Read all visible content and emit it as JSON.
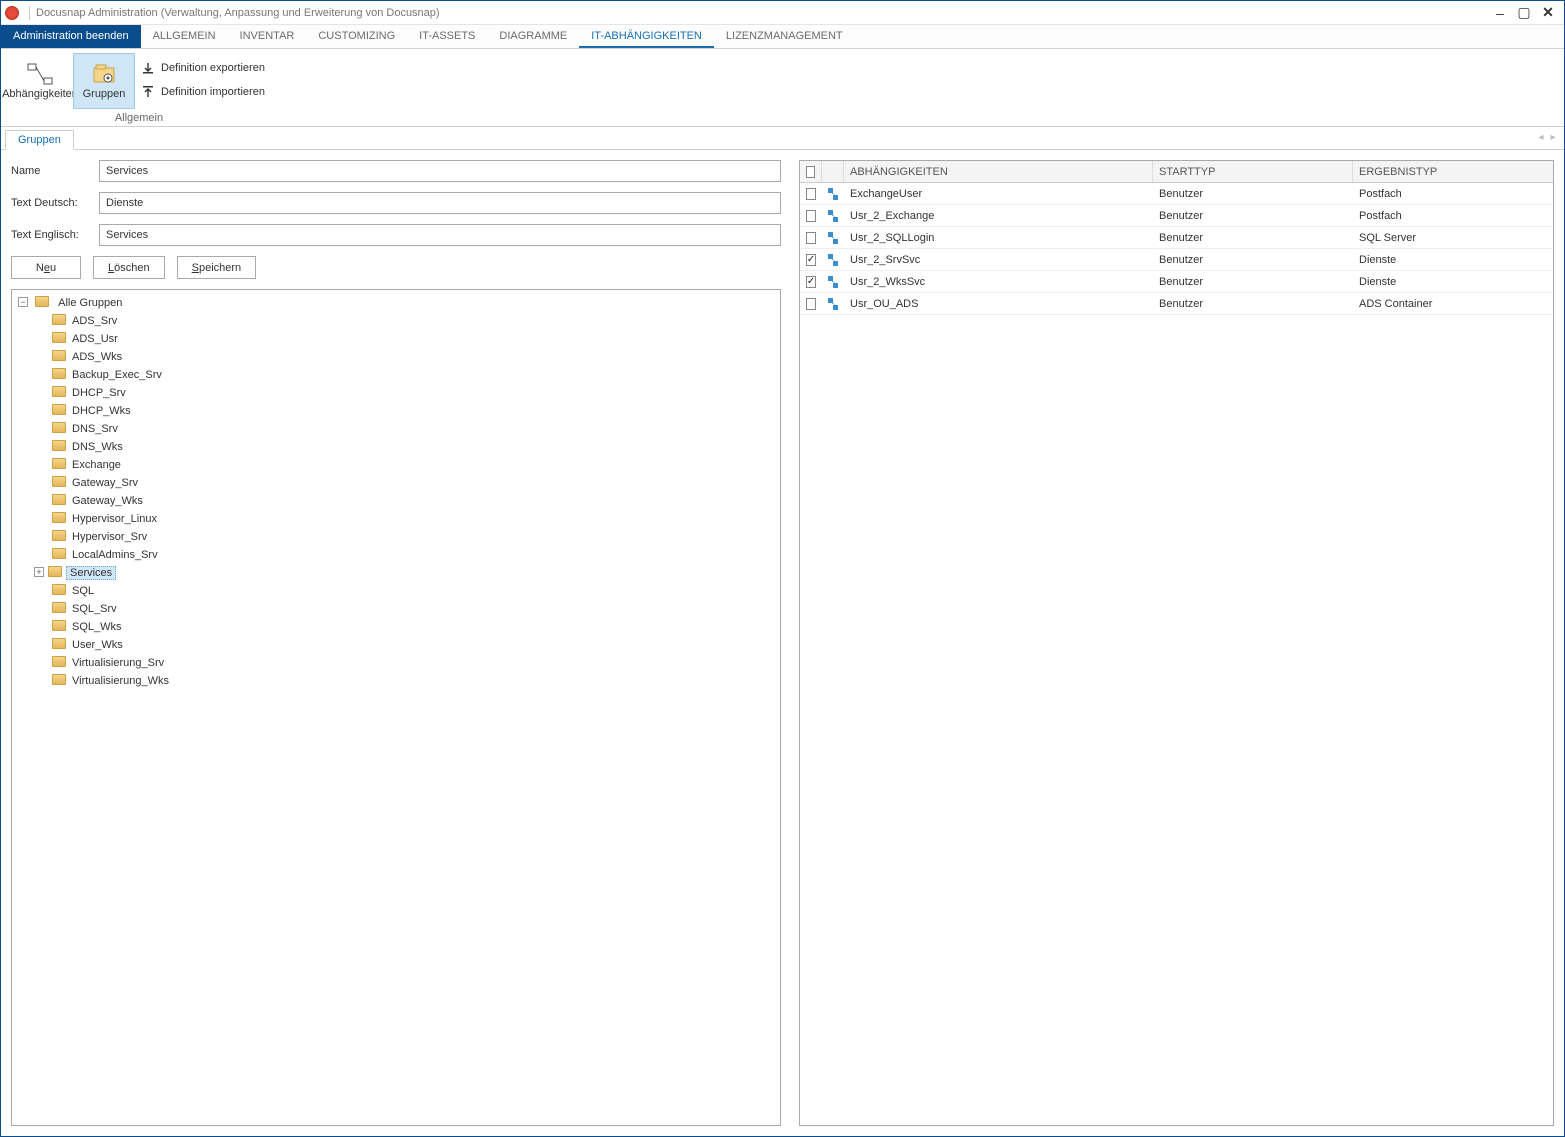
{
  "window": {
    "title": "Docusnap Administration (Verwaltung, Anpassung und Erweiterung von Docusnap)",
    "minimize": "–",
    "maximize": "▢",
    "close": "✕"
  },
  "ribbon": {
    "tabs": {
      "primary": "Administration beenden",
      "t1": "ALLGEMEIN",
      "t2": "INVENTAR",
      "t3": "CUSTOMIZING",
      "t4": "IT-ASSETS",
      "t5": "DIAGRAMME",
      "t6": "IT-ABHÄNGIGKEITEN",
      "t7": "LIZENZMANAGEMENT"
    },
    "buttons": {
      "abh": "Abhängigkeiten",
      "grp": "Gruppen",
      "exp": "Definition exportieren",
      "imp": "Definition importieren"
    },
    "group_label": "Allgemein"
  },
  "content_tab": "Gruppen",
  "form": {
    "name_label": "Name",
    "name_value": "Services",
    "de_label": "Text Deutsch:",
    "de_value": "Dienste",
    "en_label": "Text Englisch:",
    "en_value": "Services",
    "btn_new_pre": "N",
    "btn_new_u": "e",
    "btn_new_post": "u",
    "btn_del_pre": "",
    "btn_del_u": "L",
    "btn_del_post": "öschen",
    "btn_save_pre": "",
    "btn_save_u": "S",
    "btn_save_post": "peichern"
  },
  "tree": {
    "root": "Alle Gruppen",
    "items": [
      "ADS_Srv",
      "ADS_Usr",
      "ADS_Wks",
      "Backup_Exec_Srv",
      "DHCP_Srv",
      "DHCP_Wks",
      "DNS_Srv",
      "DNS_Wks",
      "Exchange",
      "Gateway_Srv",
      "Gateway_Wks",
      "Hypervisor_Linux",
      "Hypervisor_Srv",
      "LocalAdmins_Srv",
      "Services",
      "SQL",
      "SQL_Srv",
      "SQL_Wks",
      "User_Wks",
      "Virtualisierung_Srv",
      "Virtualisierung_Wks"
    ],
    "selected": "Services"
  },
  "grid": {
    "head": {
      "dep": "ABHÄNGIGKEITEN",
      "start": "STARTTYP",
      "res": "ERGEBNISTYP"
    },
    "rows": [
      {
        "chk": false,
        "dep": "ExchangeUser",
        "start": "Benutzer",
        "res": "Postfach"
      },
      {
        "chk": false,
        "dep": "Usr_2_Exchange",
        "start": "Benutzer",
        "res": "Postfach"
      },
      {
        "chk": false,
        "dep": "Usr_2_SQLLogin",
        "start": "Benutzer",
        "res": "SQL Server"
      },
      {
        "chk": true,
        "dep": "Usr_2_SrvSvc",
        "start": "Benutzer",
        "res": "Dienste"
      },
      {
        "chk": true,
        "dep": "Usr_2_WksSvc",
        "start": "Benutzer",
        "res": "Dienste"
      },
      {
        "chk": false,
        "dep": "Usr_OU_ADS",
        "start": "Benutzer",
        "res": "ADS Container"
      }
    ]
  }
}
